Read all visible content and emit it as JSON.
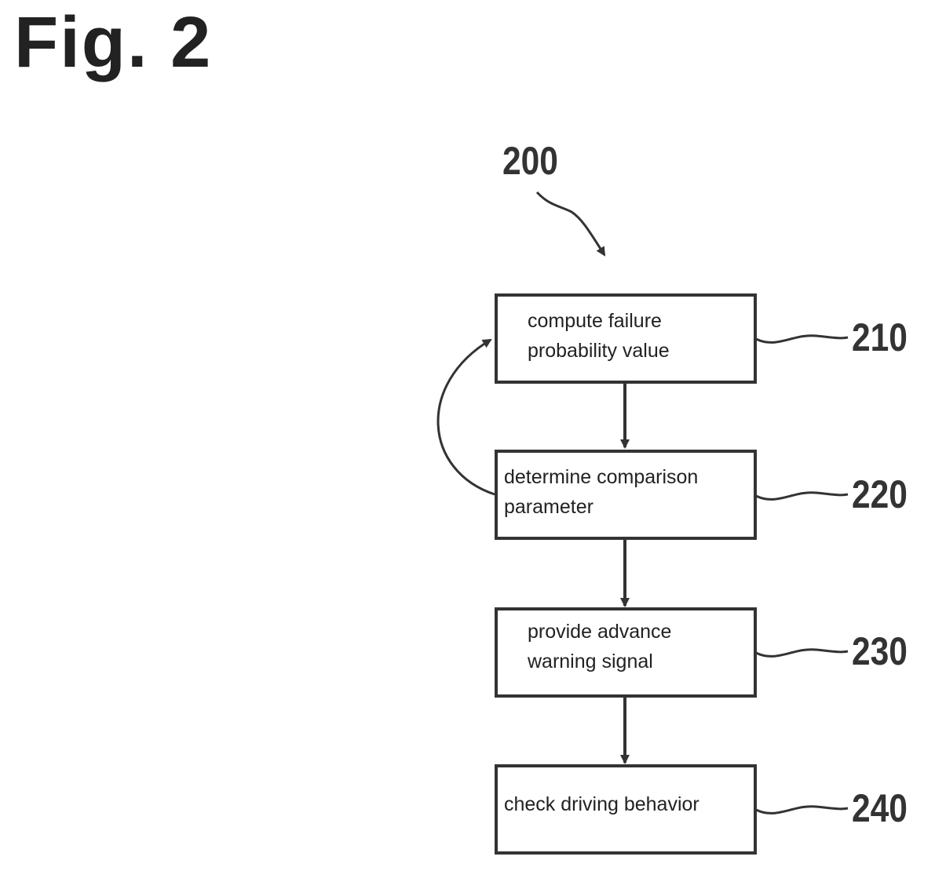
{
  "figure": {
    "title": "Fig. 2",
    "method_reference": "200"
  },
  "steps": [
    {
      "ref": "210",
      "lines": [
        "compute failure",
        "probability value"
      ]
    },
    {
      "ref": "220",
      "lines": [
        "determine comparison",
        "parameter"
      ]
    },
    {
      "ref": "230",
      "lines": [
        "provide advance",
        "warning signal"
      ]
    },
    {
      "ref": "240",
      "lines": [
        "check driving behavior"
      ]
    }
  ],
  "connections": [
    {
      "from": "210",
      "to": "220",
      "type": "arrow"
    },
    {
      "from": "220",
      "to": "230",
      "type": "arrow"
    },
    {
      "from": "230",
      "to": "240",
      "type": "arrow"
    },
    {
      "from": "220",
      "to": "210",
      "type": "loop-back-arrow"
    }
  ]
}
